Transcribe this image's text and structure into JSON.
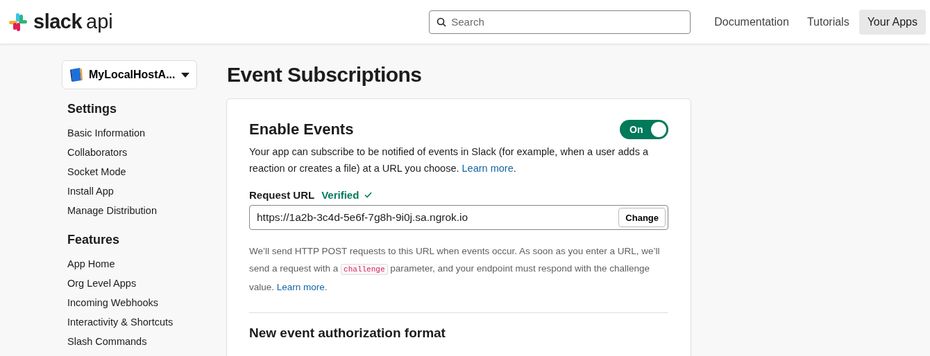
{
  "header": {
    "logo": {
      "brand": "slack",
      "suffix": "api"
    },
    "search": {
      "placeholder": "Search"
    },
    "nav": [
      {
        "label": "Documentation",
        "selected": false
      },
      {
        "label": "Tutorials",
        "selected": false
      },
      {
        "label": "Your Apps",
        "selected": true
      }
    ]
  },
  "sidebar": {
    "app_selector": "MyLocalHostA...",
    "sections": [
      {
        "title": "Settings",
        "items": [
          "Basic Information",
          "Collaborators",
          "Socket Mode",
          "Install App",
          "Manage Distribution"
        ]
      },
      {
        "title": "Features",
        "items": [
          "App Home",
          "Org Level Apps",
          "Incoming Webhooks",
          "Interactivity & Shortcuts",
          "Slash Commands"
        ]
      }
    ]
  },
  "page_title": "Event Subscriptions",
  "card": {
    "title": "Enable Events",
    "toggle": {
      "label": "On",
      "on": true
    },
    "description": [
      {
        "kind": "text",
        "text": "Your app can subscribe to be notified of events in Slack (for example, when a user adds a reaction or creates a file) at a URL you choose. "
      },
      {
        "kind": "link",
        "text": "Learn more"
      },
      {
        "kind": "text",
        "text": "."
      }
    ],
    "request_url": {
      "label": "Request URL",
      "status": "Verified",
      "verified": true,
      "value": "https://1a2b-3c4d-5e6f-7g8h-9i0j.sa.ngrok.io",
      "button": "Change"
    },
    "help": [
      {
        "kind": "text",
        "text": "We’ll send HTTP POST requests to this URL when events occur. As soon as you enter a URL, we’ll send a request with a "
      },
      {
        "kind": "code",
        "text": "challenge"
      },
      {
        "kind": "text",
        "text": " parameter, and your endpoint must respond with the challenge value. "
      },
      {
        "kind": "link",
        "text": "Learn more"
      },
      {
        "kind": "text",
        "text": "."
      }
    ],
    "next_section_title": "New event authorization format"
  }
}
